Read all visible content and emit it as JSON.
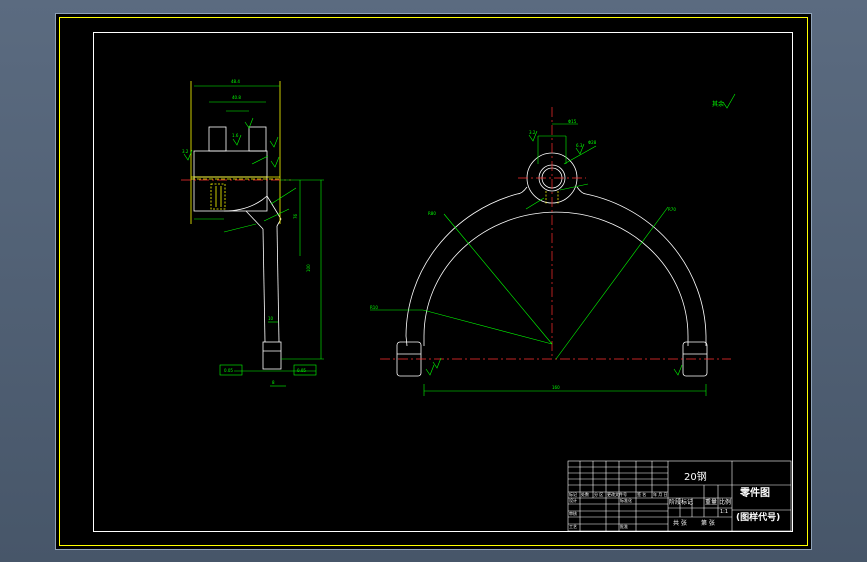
{
  "title_block": {
    "material": "20钢",
    "drawing_title": "零件图",
    "drawing_code": "(图样代号)",
    "stage_mark": "阶段标记",
    "weight": "重量",
    "scale": "比例",
    "scale_value": "1:1",
    "sheet_total": "共 张",
    "sheet_no": "第 张",
    "row_labels": [
      "标记",
      "处数",
      "分 区",
      "更改文件号",
      "签 名",
      "年 月 日"
    ],
    "role_designer": "设计",
    "role_standardize": "标准化",
    "role_checker": "审核",
    "role_process": "工艺",
    "role_approve": "批准"
  },
  "annotations": {
    "rest_mark": "其余",
    "front_radius_large": "R80",
    "front_radius_inner": "R70",
    "front_radius_left": "R10",
    "front_width": "160",
    "front_hole_dim": "Φ15",
    "front_boss_dim": "Φ28",
    "side_top_width": "48.4",
    "side_slot_width": "40.8",
    "side_height_total": "100",
    "side_height_lower": "76",
    "side_foot_dim": "10",
    "side_foot_h": "8",
    "side_foot_tol": "0.05",
    "roughness": "3.2",
    "roughness_fine": "1.6",
    "roughness_coarse": "6.3"
  }
}
